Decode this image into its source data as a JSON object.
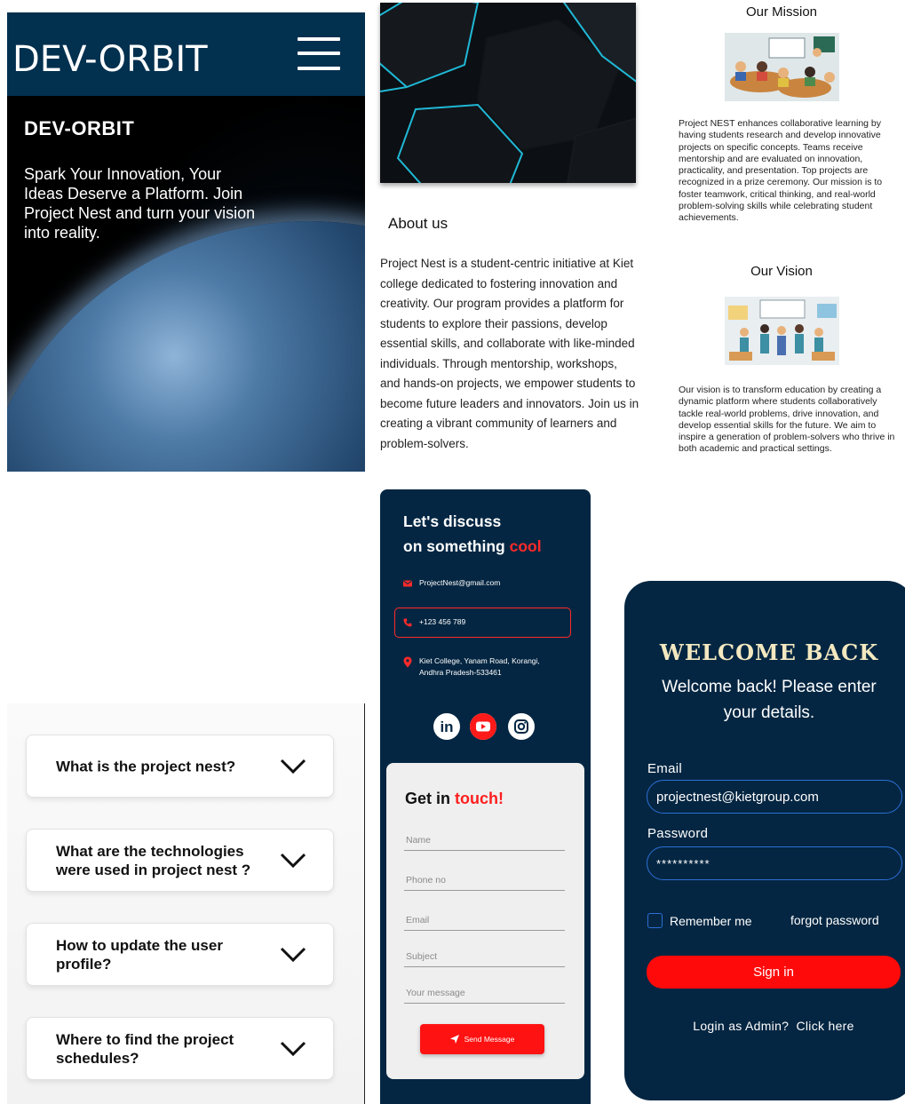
{
  "hero": {
    "logo": "DEV-ORBIT",
    "title": "DEV-ORBIT",
    "tagline": "Spark Your Innovation, Your Ideas Deserve a Platform. Join Project Nest and turn your vision into reality."
  },
  "about": {
    "title": "About us",
    "text": "Project Nest is a student-centric initiative at Kiet college dedicated to fostering innovation and creativity. Our program provides a platform for students to explore their passions, develop essential skills, and collaborate with like-minded individuals. Through mentorship, workshops, and hands-on projects, we empower students to become future leaders and innovators. Join us in creating a vibrant community of learners and problem-solvers."
  },
  "mission": {
    "title": "Our Mission",
    "text": "Project NEST enhances collaborative learning by having students research and develop innovative projects on specific concepts. Teams receive mentorship and are evaluated on innovation, practicality, and presentation. Top projects are recognized in a prize ceremony. Our mission is to foster teamwork, critical thinking, and real-world problem-solving skills while celebrating student achievements."
  },
  "vision": {
    "title": "Our Vision",
    "text": "Our vision is to transform education by creating a dynamic platform where students collaboratively tackle real-world problems, drive innovation, and develop essential skills for the future. We aim to inspire a generation of problem-solvers who thrive in both academic and practical settings."
  },
  "faq": {
    "items": [
      {
        "question": "What is the project nest?"
      },
      {
        "question": "What are the technologies were used in project nest ?"
      },
      {
        "question": "How to update the user profile?"
      },
      {
        "question": "Where to find the project schedules?"
      }
    ]
  },
  "contact": {
    "heading_line1": "Let's discuss",
    "heading_line2": "on something",
    "heading_accent": "cool",
    "email": "ProjectNest@gmail.com",
    "phone": "+123 456 789",
    "address": "Kiet College, Yanam Road, Korangi, Andhra Pradesh-533461",
    "social": [
      "linkedin-icon",
      "youtube-icon",
      "instagram-icon"
    ],
    "accent_color": "#ff2a2a",
    "form": {
      "title": "Get in",
      "title_accent": "touch!",
      "name_placeholder": "Name",
      "phone_placeholder": "Phone no",
      "email_placeholder": "Email",
      "subject_placeholder": "Subject",
      "message_placeholder": "Your message",
      "send_label": "Send Message"
    }
  },
  "login": {
    "title": "WELCOME BACK",
    "subtitle": "Welcome back! Please enter your details.",
    "email_label": "Email",
    "email_value": "projectnest@kietgroup.com",
    "password_label": "Password",
    "password_value": "**********",
    "remember_label": "Remember me",
    "forgot_label": "forgot password",
    "signin_label": "Sign in",
    "admin_text": "Login as Admin?",
    "admin_link": "Click here",
    "background_color": "#042642",
    "button_color": "#ff0a0a"
  }
}
